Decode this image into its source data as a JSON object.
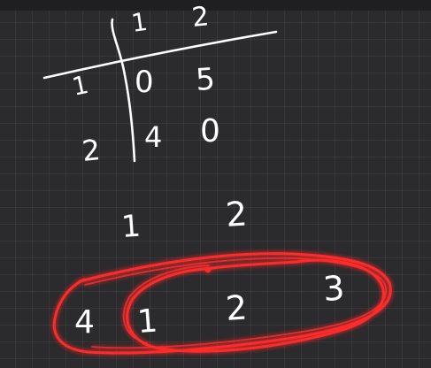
{
  "canvas": {
    "background": "#2b2a2c",
    "grid": true,
    "ink_color": "#ffffff",
    "highlight_color": "#ff2a2a"
  },
  "matrix": {
    "col_headers": [
      "1",
      "2"
    ],
    "row_headers": [
      "1",
      "2"
    ],
    "cells": [
      [
        "0",
        "5"
      ],
      [
        "4",
        "0"
      ]
    ]
  },
  "sequence": {
    "labels": [
      "1",
      "2"
    ],
    "values": [
      "4",
      "1",
      "2",
      "3"
    ]
  }
}
